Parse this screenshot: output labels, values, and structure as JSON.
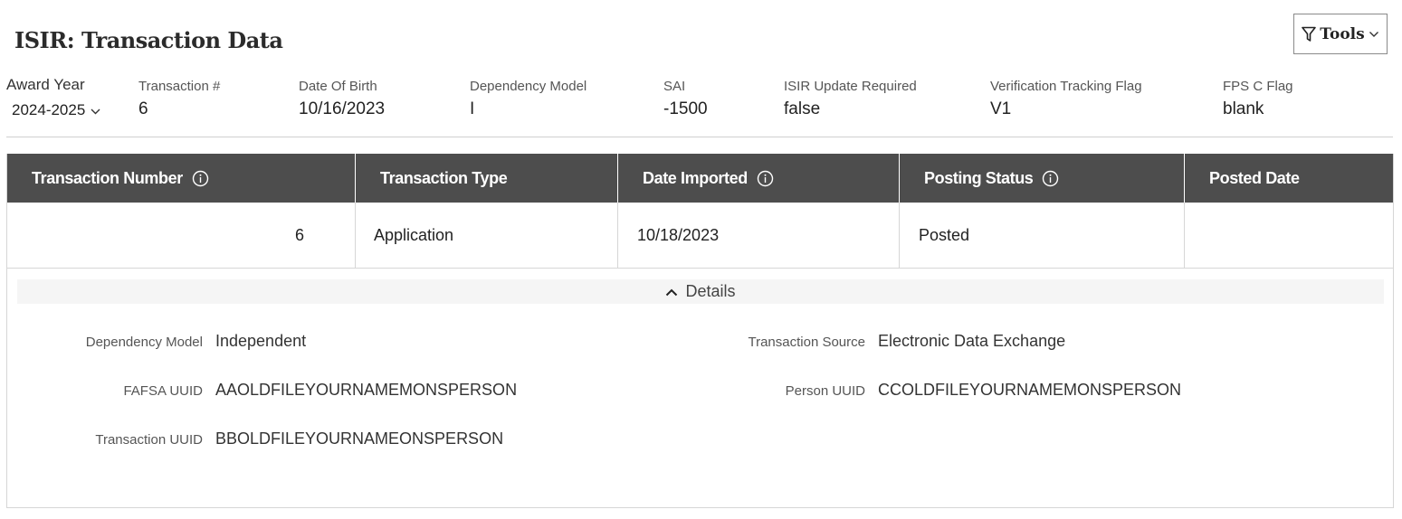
{
  "header": {
    "title": "ISIR: Transaction Data",
    "tools_label": "Tools"
  },
  "summary": {
    "award_year": {
      "label": "Award Year",
      "value": "2024-2025"
    },
    "fields": [
      {
        "label": "Transaction #",
        "value": "6"
      },
      {
        "label": "Date Of Birth",
        "value": "10/16/2023"
      },
      {
        "label": "Dependency Model",
        "value": "I"
      },
      {
        "label": "SAI",
        "value": "-1500"
      },
      {
        "label": "ISIR Update Required",
        "value": "false"
      },
      {
        "label": "Verification Tracking Flag",
        "value": "V1"
      },
      {
        "label": "FPS C Flag",
        "value": "blank"
      }
    ]
  },
  "table": {
    "columns": [
      {
        "label": "Transaction Number",
        "info": true
      },
      {
        "label": "Transaction Type",
        "info": false
      },
      {
        "label": "Date Imported",
        "info": true
      },
      {
        "label": "Posting Status",
        "info": true
      },
      {
        "label": "Posted Date",
        "info": false
      }
    ],
    "rows": [
      {
        "transaction_number": "6",
        "transaction_type": "Application",
        "date_imported": "10/18/2023",
        "posting_status": "Posted",
        "posted_date": ""
      }
    ]
  },
  "details": {
    "toggle_label": "Details",
    "left": [
      {
        "label": "Dependency Model",
        "value": "Independent"
      },
      {
        "label": "FAFSA UUID",
        "value": "AAOLDFILEYOURNAMEMONSPERSON"
      },
      {
        "label": "Transaction UUID",
        "value": "BBOLDFILEYOURNAMEONSPERSON"
      }
    ],
    "right": [
      {
        "label": "Transaction Source",
        "value": "Electronic Data Exchange"
      },
      {
        "label": "Person UUID",
        "value": "CCOLDFILEYOURNAMEMONSPERSON"
      }
    ]
  }
}
